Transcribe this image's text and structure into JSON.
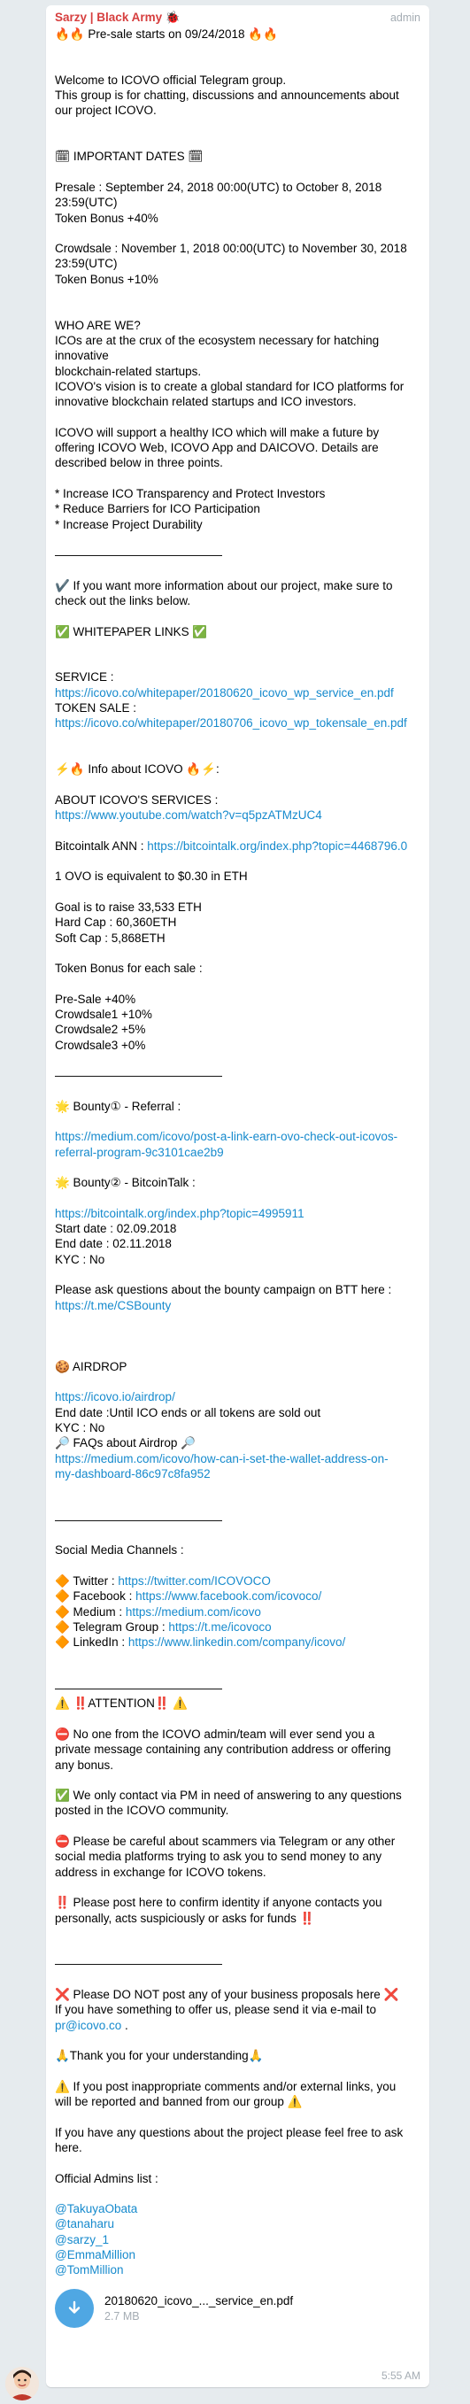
{
  "message": {
    "sender": "Sarzy | Black Army 🐞",
    "role": "admin",
    "time": "5:55 AM",
    "lines": [
      {
        "t": "🔥🔥 Pre-sale starts on 09/24/2018 🔥🔥"
      },
      {
        "t": ""
      },
      {
        "t": ""
      },
      {
        "t": "Welcome to ICOVO official Telegram group."
      },
      {
        "t": "This group is for chatting, discussions and announcements about"
      },
      {
        "t": "our project ICOVO."
      },
      {
        "t": ""
      },
      {
        "t": ""
      },
      {
        "t": "🗓 IMPORTANT DATES 🗓"
      },
      {
        "t": ""
      },
      {
        "t": "Presale : September 24, 2018 00:00(UTC) to October 8, 2018"
      },
      {
        "t": "23:59(UTC)"
      },
      {
        "t": "Token Bonus +40%"
      },
      {
        "t": ""
      },
      {
        "t": "Crowdsale : November 1, 2018 00:00(UTC) to November 30, 2018"
      },
      {
        "t": "23:59(UTC)"
      },
      {
        "t": "Token Bonus +10%"
      },
      {
        "t": ""
      },
      {
        "t": ""
      },
      {
        "t": "WHO ARE WE?"
      },
      {
        "t": "ICOs are at the crux of the ecosystem necessary for hatching"
      },
      {
        "t": "innovative"
      },
      {
        "t": "blockchain-related startups."
      },
      {
        "t": "ICOVO's vision is to create a global standard for ICO platforms for"
      },
      {
        "t": "innovative blockchain related startups and ICO investors."
      },
      {
        "t": ""
      },
      {
        "t": "ICOVO will support a healthy ICO which will make a future by"
      },
      {
        "t": "offering ICOVO Web, ICOVO App and DAICOVO. Details are"
      },
      {
        "t": "described below in three points."
      },
      {
        "t": ""
      },
      {
        "t": "* Increase ICO Transparency and Protect Investors"
      },
      {
        "t": "* Reduce Barriers for ICO Participation"
      },
      {
        "t": "* Increase Project Durability"
      },
      {
        "t": ""
      },
      {
        "t": "——————————————"
      },
      {
        "t": ""
      },
      {
        "t": "✔️ If you want more information about our project, make sure to"
      },
      {
        "t": "check out the links below."
      },
      {
        "t": ""
      },
      {
        "t": "✅ WHITEPAPER LINKS ✅"
      },
      {
        "t": ""
      },
      {
        "t": ""
      },
      {
        "t": "SERVICE :"
      },
      {
        "t": "https://icovo.co/whitepaper/20180620_icovo_wp_service_en.pdf",
        "link": true
      },
      {
        "t": "TOKEN SALE :"
      },
      {
        "t": "https://icovo.co/whitepaper/20180706_icovo_wp_tokensale_en.pdf",
        "link": true
      },
      {
        "t": ""
      },
      {
        "t": ""
      },
      {
        "t": "⚡️🔥 Info about ICOVO 🔥⚡️:"
      },
      {
        "t": ""
      },
      {
        "t": "ABOUT ICOVO'S SERVICES :"
      },
      {
        "t": "https://www.youtube.com/watch?v=q5pzATMzUC4",
        "link": true
      },
      {
        "t": ""
      },
      {
        "t": "Bitcointalk ANN : ",
        "after": "https://bitcointalk.org/index.php?topic=4468796.0"
      },
      {
        "t": ""
      },
      {
        "t": "1 OVO is equivalent to $0.30 in ETH"
      },
      {
        "t": ""
      },
      {
        "t": "Goal is to raise 33,533 ETH"
      },
      {
        "t": "Hard Cap : 60,360ETH"
      },
      {
        "t": "Soft Cap : 5,868ETH"
      },
      {
        "t": ""
      },
      {
        "t": "Token Bonus for each sale :"
      },
      {
        "t": ""
      },
      {
        "t": "Pre-Sale +40%"
      },
      {
        "t": "Crowdsale1 +10%"
      },
      {
        "t": "Crowdsale2 +5%"
      },
      {
        "t": "Crowdsale3 +0%"
      },
      {
        "t": ""
      },
      {
        "t": "——————————————"
      },
      {
        "t": ""
      },
      {
        "t": "🌟 Bounty① - Referral :"
      },
      {
        "t": ""
      },
      {
        "t": "https://medium.com/icovo/post-a-link-earn-ovo-check-out-icovos-",
        "link": true
      },
      {
        "t": "referral-program-9c3101cae2b9",
        "link": true
      },
      {
        "t": ""
      },
      {
        "t": "🌟 Bounty② - BitcoinTalk :"
      },
      {
        "t": ""
      },
      {
        "t": "https://bitcointalk.org/index.php?topic=4995911",
        "link": true
      },
      {
        "t": "Start date : 02.09.2018"
      },
      {
        "t": "End date : 02.11.2018"
      },
      {
        "t": "KYC : No"
      },
      {
        "t": ""
      },
      {
        "t": "Please ask questions about the bounty campaign on BTT here :"
      },
      {
        "t": "https://t.me/CSBounty",
        "link": true
      },
      {
        "t": ""
      },
      {
        "t": ""
      },
      {
        "t": ""
      },
      {
        "t": "🍪 AIRDROP"
      },
      {
        "t": ""
      },
      {
        "t": "https://icovo.io/airdrop/",
        "link": true
      },
      {
        "t": "End date :Until ICO ends or all tokens are sold out"
      },
      {
        "t": "KYC : No"
      },
      {
        "t": "🔎 FAQs about Airdrop 🔎"
      },
      {
        "t": "https://medium.com/icovo/how-can-i-set-the-wallet-address-on-",
        "link": true
      },
      {
        "t": "my-dashboard-86c97c8fa952",
        "link": true
      },
      {
        "t": ""
      },
      {
        "t": ""
      },
      {
        "t": "——————————————"
      },
      {
        "t": ""
      },
      {
        "t": "Social Media Channels :"
      },
      {
        "t": ""
      },
      {
        "t": "🔶 Twitter : ",
        "after": "https://twitter.com/ICOVOCO"
      },
      {
        "t": "🔶 Facebook : ",
        "after": "https://www.facebook.com/icovoco/"
      },
      {
        "t": "🔶 Medium : ",
        "after": "https://medium.com/icovo"
      },
      {
        "t": "🔶 Telegram Group : ",
        "after": "https://t.me/icovoco"
      },
      {
        "t": "🔶 LinkedIn : ",
        "after": "https://www.linkedin.com/company/icovo/"
      },
      {
        "t": ""
      },
      {
        "t": ""
      },
      {
        "t": "——————————————"
      },
      {
        "t": "⚠️ ‼️ATTENTION‼️ ⚠️"
      },
      {
        "t": ""
      },
      {
        "t": "⛔️ No one from the ICOVO admin/team will ever send you a"
      },
      {
        "t": "private message containing any contribution address or offering"
      },
      {
        "t": "any bonus."
      },
      {
        "t": ""
      },
      {
        "t": "✅ We only contact via PM in need of answering to any questions"
      },
      {
        "t": "posted in the ICOVO community."
      },
      {
        "t": ""
      },
      {
        "t": "⛔️ Please be careful about scammers via Telegram or any other"
      },
      {
        "t": "social media platforms trying to ask you to send money to any"
      },
      {
        "t": "address in exchange for ICOVO tokens."
      },
      {
        "t": ""
      },
      {
        "t": "‼️ Please post here to confirm identity if anyone contacts you"
      },
      {
        "t": "personally, acts suspiciously or asks for funds ‼️"
      },
      {
        "t": ""
      },
      {
        "t": ""
      },
      {
        "t": "——————————————"
      },
      {
        "t": ""
      },
      {
        "t": "❌ Please DO NOT post any of your business proposals here ❌"
      },
      {
        "t": "If you have something to offer us, please send it via e-mail to"
      },
      {
        "t": "",
        "after": "pr@icovo.co",
        "tail": " ."
      },
      {
        "t": ""
      },
      {
        "t": "🙏Thank you for your understanding🙏"
      },
      {
        "t": ""
      },
      {
        "t": "⚠️ If you post inappropriate comments and/or external links, you"
      },
      {
        "t": "will be reported and banned from our group ⚠️"
      },
      {
        "t": ""
      },
      {
        "t": "If you have any questions about the project please feel free to ask"
      },
      {
        "t": "here."
      },
      {
        "t": ""
      },
      {
        "t": "Official Admins list :"
      },
      {
        "t": ""
      },
      {
        "t": "@TakuyaObata",
        "link": true
      },
      {
        "t": "@tanaharu",
        "link": true
      },
      {
        "t": "@sarzy_1",
        "link": true
      },
      {
        "t": "@EmmaMillion",
        "link": true
      },
      {
        "t": "@TomMillion",
        "link": true
      }
    ],
    "attachment": {
      "name": "20180620_icovo_..._service_en.pdf",
      "size": "2.7 MB",
      "icon": "download-icon"
    }
  },
  "colors": {
    "background": "#e6ebee",
    "bubble": "#ffffff",
    "sender": "#d63e3e",
    "link": "#168acd",
    "meta": "#a4acb3",
    "file_button": "#4fa7e3"
  }
}
